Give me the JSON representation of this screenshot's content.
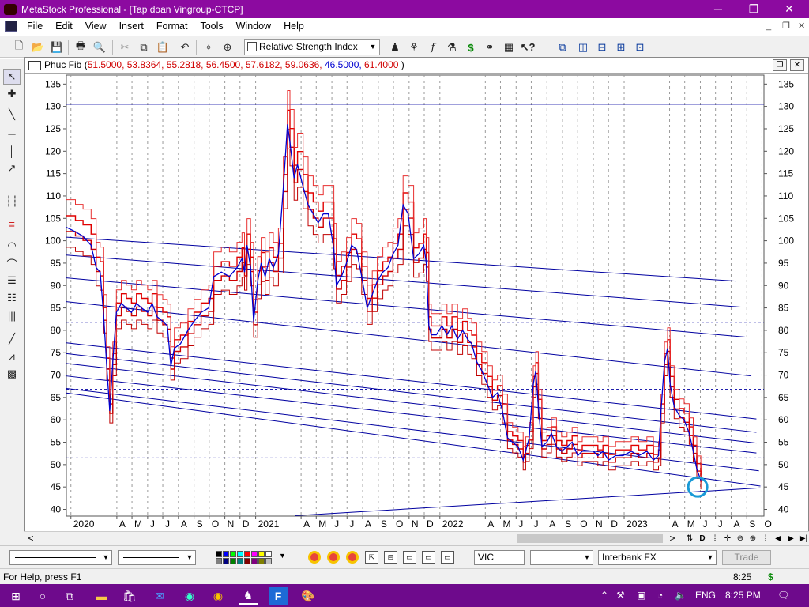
{
  "window": {
    "title": "MetaStock Professional - [Tap doan Vingroup-CTCP]",
    "minimize": "─",
    "restore": "❐",
    "close": "✕"
  },
  "menu": {
    "items": [
      "File",
      "Edit",
      "View",
      "Insert",
      "Format",
      "Tools",
      "Window",
      "Help"
    ],
    "mdi": [
      "_",
      "❐",
      "✕"
    ]
  },
  "toolbar": {
    "indicator_select": "Relative Strength Index"
  },
  "chart_window": {
    "title": "Phuc Fib",
    "params_red_1": "51.5000, 53.8364, 55.2818, 56.4500, 57.6182, 59.0636,",
    "params_blue": "46.5000,",
    "params_red_2": "61.4000",
    "open_paren": "(",
    "close_paren": ")",
    "restore": "❐",
    "close": "✕"
  },
  "chart_data": {
    "type": "line",
    "title": "Phuc Fib",
    "y_ticks": [
      40,
      45,
      50,
      55,
      60,
      65,
      70,
      75,
      80,
      85,
      90,
      95,
      100,
      105,
      110,
      115,
      120,
      125,
      130,
      135
    ],
    "ylim": [
      38.5,
      137
    ],
    "x_labels": [
      "2020",
      "A",
      "M",
      "J",
      "J",
      "A",
      "S",
      "O",
      "N",
      "D",
      "2021",
      "A",
      "M",
      "J",
      "J",
      "A",
      "S",
      "O",
      "N",
      "D",
      "2022",
      "A",
      "M",
      "J",
      "J",
      "A",
      "S",
      "O",
      "N",
      "D",
      "2023",
      "A",
      "M",
      "J",
      "J",
      "A",
      "S",
      "O"
    ],
    "horizontal_lines": [
      {
        "y": 130.5,
        "style": "solid",
        "color": "#0000a0"
      },
      {
        "y": 81.8,
        "style": "dotted",
        "color": "#0000a0"
      },
      {
        "y": 66.8,
        "style": "dotted",
        "color": "#0000a0"
      },
      {
        "y": 51.5,
        "style": "dotted",
        "color": "#0000a0"
      }
    ],
    "trend_lines": [
      {
        "x1": "2019-12-23",
        "y1": 100.8,
        "x2": "2023-08-10",
        "y2": 91.0
      },
      {
        "x1": "2019-12-23",
        "y1": 96.8,
        "x2": "2023-08-20",
        "y2": 85.2
      },
      {
        "x1": "2019-12-23",
        "y1": 91.7,
        "x2": "2023-08-28",
        "y2": 78.5
      },
      {
        "x1": "2019-12-23",
        "y1": 86.4,
        "x2": "2023-09-10",
        "y2": 69.8
      },
      {
        "x1": "2019-12-23",
        "y1": 77.2,
        "x2": "2023-09-20",
        "y2": 60.2
      },
      {
        "x1": "2019-12-23",
        "y1": 74.8,
        "x2": "2023-09-20",
        "y2": 57.2
      },
      {
        "x1": "2019-12-23",
        "y1": 72.6,
        "x2": "2023-09-20",
        "y2": 54.8
      },
      {
        "x1": "2019-12-23",
        "y1": 69.8,
        "x2": "2023-09-20",
        "y2": 52.6
      },
      {
        "x1": "2019-12-23",
        "y1": 67.0,
        "x2": "2023-09-25",
        "y2": 48.6
      },
      {
        "x1": "2019-12-23",
        "y1": 66.0,
        "x2": "2023-09-28",
        "y2": 45.2
      },
      {
        "x1": "2021-03-20",
        "y1": 38.6,
        "x2": "2023-09-28",
        "y2": 44.8
      }
    ],
    "series": [
      {
        "name": "VIC",
        "color": "#0000d0",
        "points": [
          [
            "2019-12-23",
            103
          ],
          [
            "2020-01-10",
            102
          ],
          [
            "2020-01-25",
            101
          ],
          [
            "2020-02-10",
            99
          ],
          [
            "2020-02-20",
            94
          ],
          [
            "2020-02-28",
            93
          ],
          [
            "2020-03-06",
            83
          ],
          [
            "2020-03-12",
            72
          ],
          [
            "2020-03-18",
            62
          ],
          [
            "2020-03-24",
            73
          ],
          [
            "2020-03-31",
            84
          ],
          [
            "2020-04-10",
            86
          ],
          [
            "2020-04-20",
            85
          ],
          [
            "2020-04-30",
            84
          ],
          [
            "2020-05-10",
            86
          ],
          [
            "2020-05-20",
            85
          ],
          [
            "2020-06-01",
            84
          ],
          [
            "2020-06-10",
            86
          ],
          [
            "2020-06-20",
            83
          ],
          [
            "2020-07-01",
            82
          ],
          [
            "2020-07-10",
            81
          ],
          [
            "2020-07-17",
            72
          ],
          [
            "2020-07-24",
            76
          ],
          [
            "2020-08-05",
            77
          ],
          [
            "2020-08-20",
            80
          ],
          [
            "2020-09-01",
            82
          ],
          [
            "2020-09-15",
            84
          ],
          [
            "2020-09-30",
            85
          ],
          [
            "2020-10-10",
            92
          ],
          [
            "2020-10-25",
            93
          ],
          [
            "2020-11-10",
            92
          ],
          [
            "2020-11-25",
            94
          ],
          [
            "2020-12-05",
            96
          ],
          [
            "2020-12-10",
            93
          ],
          [
            "2020-12-15",
            99
          ],
          [
            "2020-12-22",
            94
          ],
          [
            "2020-12-28",
            82
          ],
          [
            "2021-01-05",
            91
          ],
          [
            "2021-01-12",
            95
          ],
          [
            "2021-01-20",
            92
          ],
          [
            "2021-01-28",
            96
          ],
          [
            "2021-02-05",
            94
          ],
          [
            "2021-02-15",
            97
          ],
          [
            "2021-02-25",
            112
          ],
          [
            "2021-03-05",
            126
          ],
          [
            "2021-03-10",
            122
          ],
          [
            "2021-03-18",
            114
          ],
          [
            "2021-03-25",
            117
          ],
          [
            "2021-04-05",
            112
          ],
          [
            "2021-04-15",
            108
          ],
          [
            "2021-04-25",
            106
          ],
          [
            "2021-05-05",
            104
          ],
          [
            "2021-05-15",
            106
          ],
          [
            "2021-05-25",
            106
          ],
          [
            "2021-06-05",
            98
          ],
          [
            "2021-06-10",
            90
          ],
          [
            "2021-06-20",
            92
          ],
          [
            "2021-06-30",
            95
          ],
          [
            "2021-07-10",
            99
          ],
          [
            "2021-07-20",
            98
          ],
          [
            "2021-07-30",
            92
          ],
          [
            "2021-08-10",
            85
          ],
          [
            "2021-08-20",
            88
          ],
          [
            "2021-08-30",
            91
          ],
          [
            "2021-09-10",
            93
          ],
          [
            "2021-09-20",
            94
          ],
          [
            "2021-09-30",
            97
          ],
          [
            "2021-10-10",
            99
          ],
          [
            "2021-10-20",
            108
          ],
          [
            "2021-10-30",
            106
          ],
          [
            "2021-11-10",
            96
          ],
          [
            "2021-11-20",
            97
          ],
          [
            "2021-11-30",
            99
          ],
          [
            "2021-12-05",
            95
          ],
          [
            "2021-12-10",
            81
          ],
          [
            "2021-12-15",
            79
          ],
          [
            "2021-12-25",
            79
          ],
          [
            "2022-01-05",
            81
          ],
          [
            "2022-01-15",
            79
          ],
          [
            "2022-01-25",
            81
          ],
          [
            "2022-02-05",
            78
          ],
          [
            "2022-02-15",
            80
          ],
          [
            "2022-02-25",
            78
          ],
          [
            "2022-03-05",
            77
          ],
          [
            "2022-03-15",
            73
          ],
          [
            "2022-03-25",
            71
          ],
          [
            "2022-04-05",
            68
          ],
          [
            "2022-04-15",
            65
          ],
          [
            "2022-04-25",
            66
          ],
          [
            "2022-05-05",
            62
          ],
          [
            "2022-05-15",
            56
          ],
          [
            "2022-05-25",
            55
          ],
          [
            "2022-06-05",
            54
          ],
          [
            "2022-06-15",
            51
          ],
          [
            "2022-06-20",
            53
          ],
          [
            "2022-06-27",
            56
          ],
          [
            "2022-07-05",
            68
          ],
          [
            "2022-07-10",
            71
          ],
          [
            "2022-07-15",
            63
          ],
          [
            "2022-07-22",
            54
          ],
          [
            "2022-08-01",
            55
          ],
          [
            "2022-08-10",
            57
          ],
          [
            "2022-08-20",
            54
          ],
          [
            "2022-08-30",
            53
          ],
          [
            "2022-09-10",
            54
          ],
          [
            "2022-09-20",
            55
          ],
          [
            "2022-10-01",
            52
          ],
          [
            "2022-10-10",
            53
          ],
          [
            "2022-10-20",
            53
          ],
          [
            "2022-11-01",
            53
          ],
          [
            "2022-11-10",
            52
          ],
          [
            "2022-11-20",
            53
          ],
          [
            "2022-12-01",
            51
          ],
          [
            "2022-12-15",
            52
          ],
          [
            "2022-12-30",
            52
          ],
          [
            "2023-01-15",
            53
          ],
          [
            "2023-01-30",
            52
          ],
          [
            "2023-02-15",
            53
          ],
          [
            "2023-02-28",
            51
          ],
          [
            "2023-03-10",
            52
          ],
          [
            "2023-03-15",
            62
          ],
          [
            "2023-03-22",
            73
          ],
          [
            "2023-03-28",
            76
          ],
          [
            "2023-04-02",
            68
          ],
          [
            "2023-04-10",
            63
          ],
          [
            "2023-04-20",
            61
          ],
          [
            "2023-04-30",
            60
          ],
          [
            "2023-05-10",
            57
          ],
          [
            "2023-05-18",
            53
          ],
          [
            "2023-05-25",
            49
          ],
          [
            "2023-06-02",
            46.5
          ]
        ]
      }
    ],
    "legend": "none"
  },
  "bottom": {
    "symbol": "VIC",
    "source": "Interbank FX",
    "trade": "Trade",
    "time": "8:25"
  },
  "status": {
    "help": "For Help, press F1"
  },
  "taskbar": {
    "lang": "ENG",
    "time": "8:25 PM"
  }
}
